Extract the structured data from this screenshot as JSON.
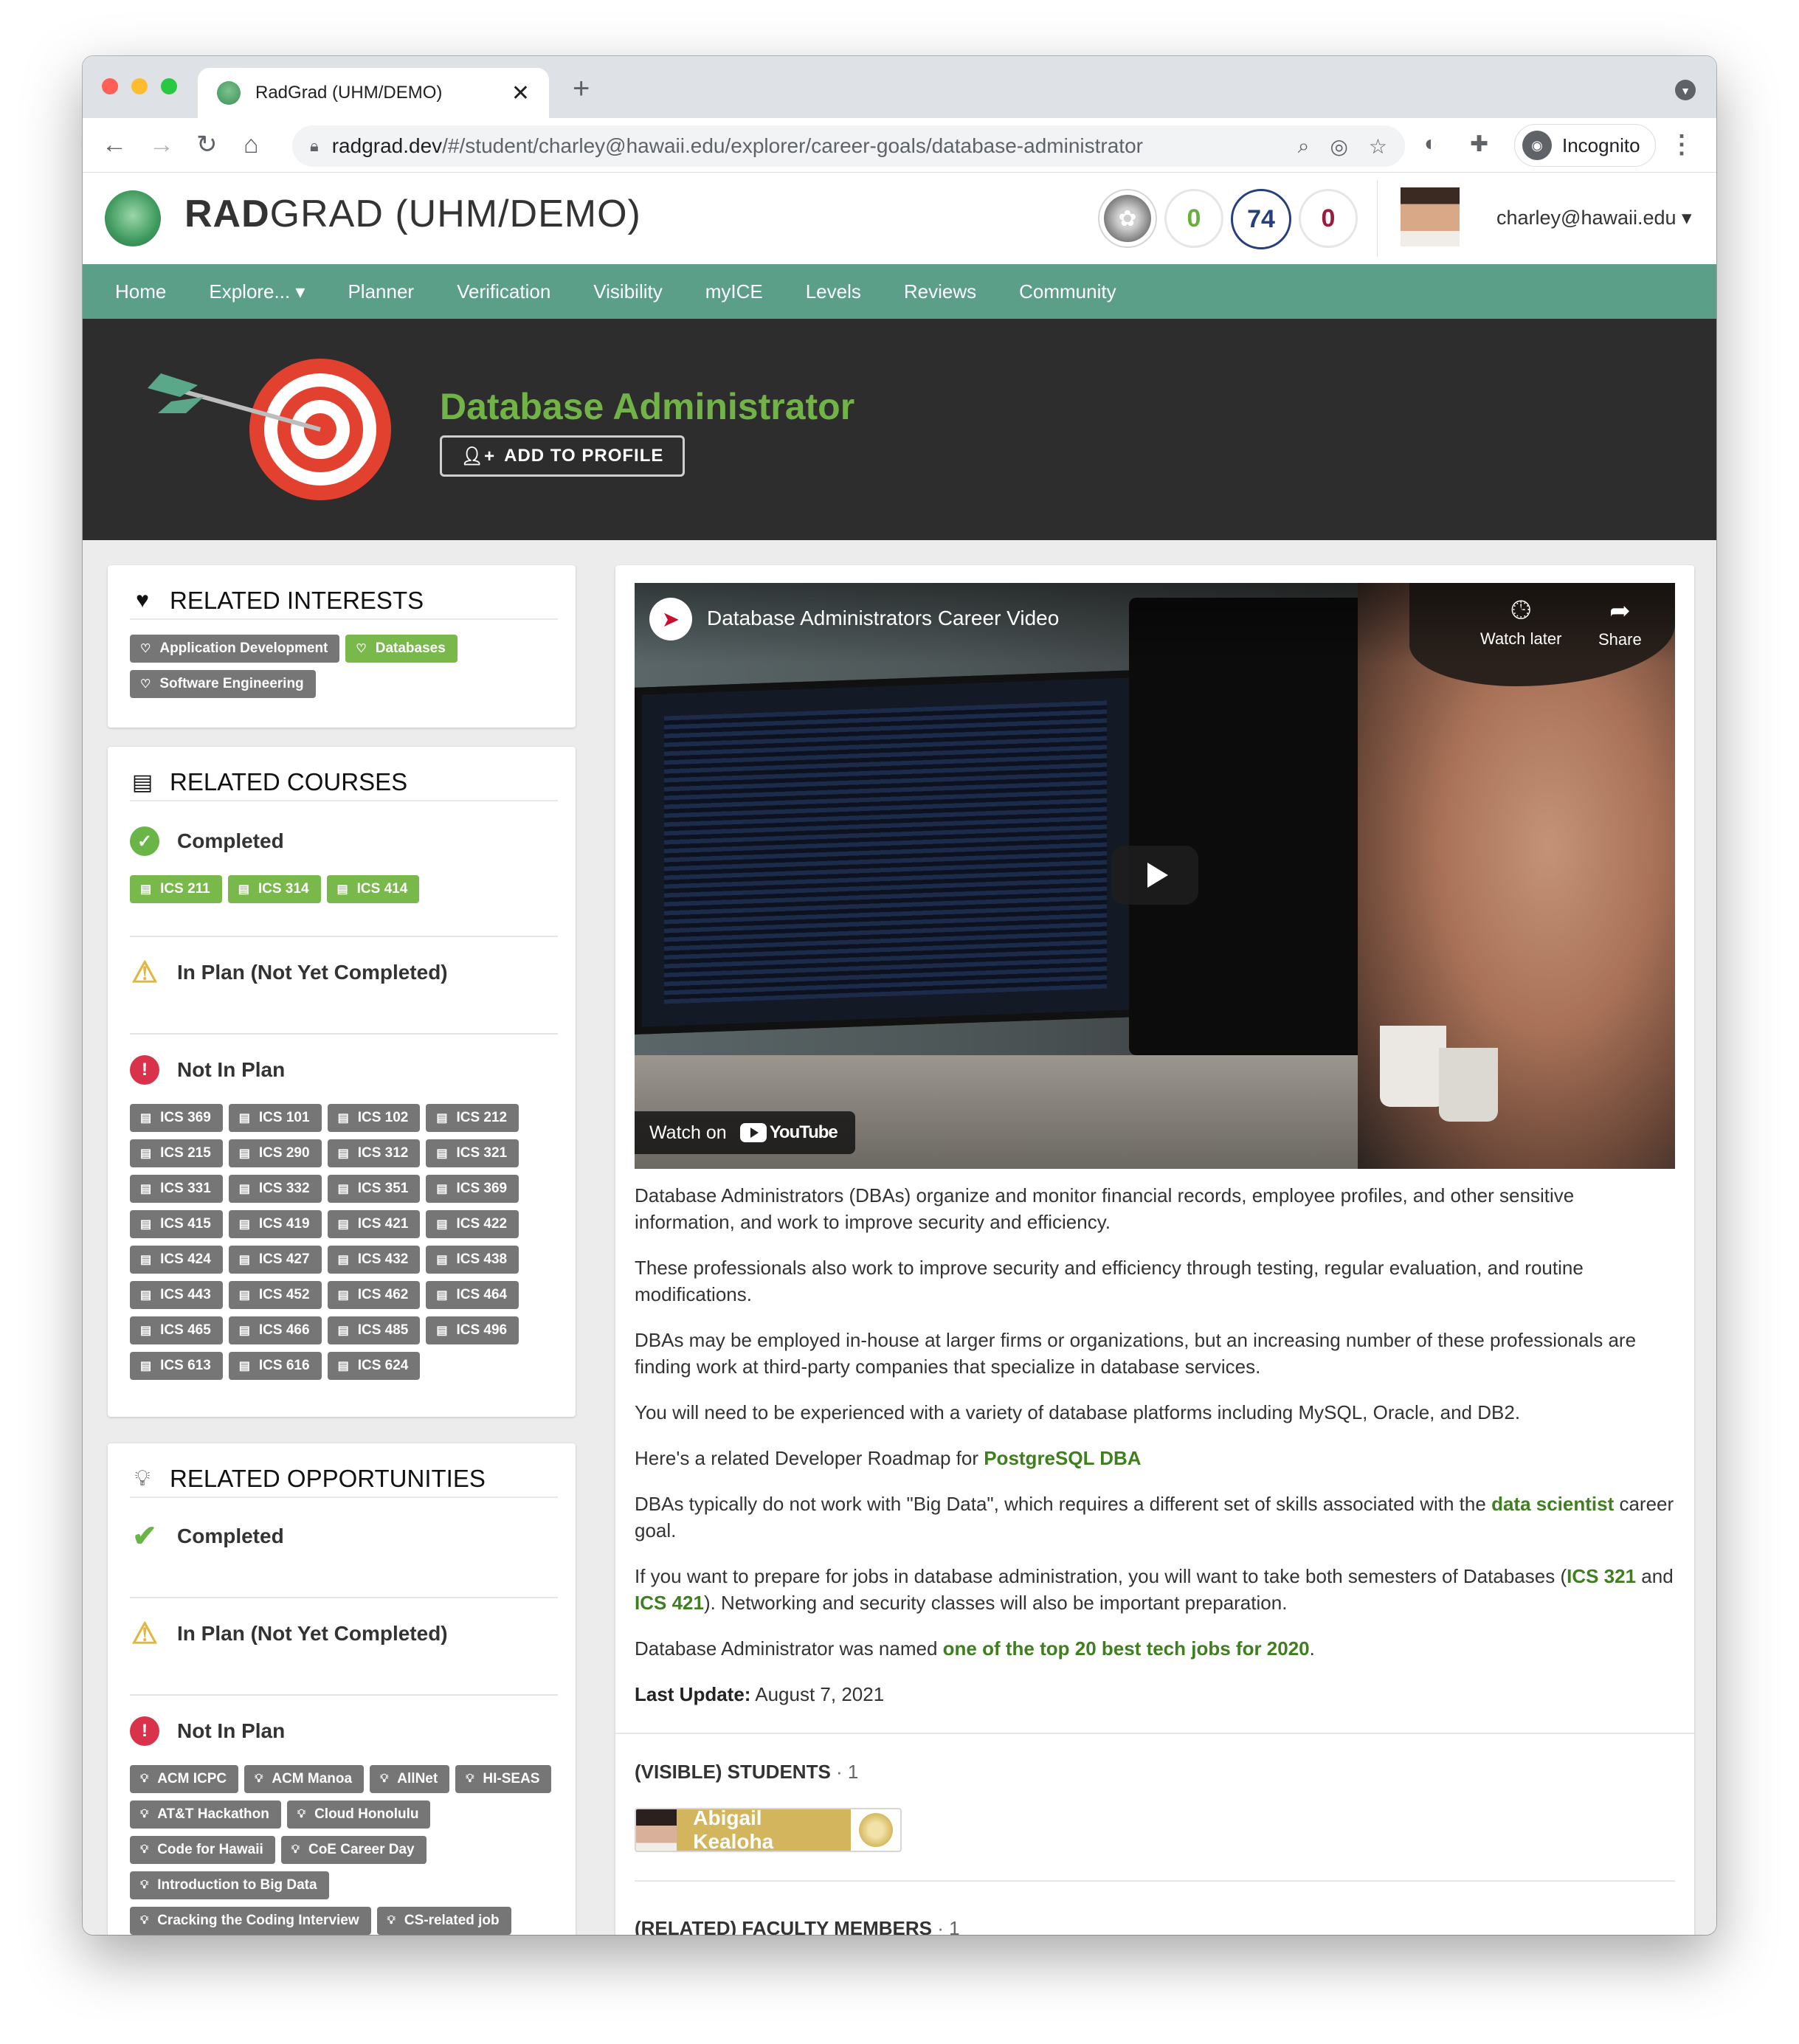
{
  "browser": {
    "tab_title": "RadGrad (UHM/DEMO)",
    "url_host": "radgrad.dev",
    "url_path": "/#/student/charley@hawaii.edu/explorer/career-goals/database-administrator",
    "incognito_label": "Incognito"
  },
  "header": {
    "brand_bold": "RAD",
    "brand_rest": "GRAD (UHM/DEMO)",
    "scores": [
      "0",
      "74",
      "0"
    ],
    "user": "charley@hawaii.edu ▾"
  },
  "nav": [
    "Home",
    "Explore... ▾",
    "Planner",
    "Verification",
    "Visibility",
    "myICE",
    "Levels",
    "Reviews",
    "Community"
  ],
  "hero": {
    "title": "Database Administrator",
    "add_button": "ADD TO PROFILE"
  },
  "interests": {
    "title": "RELATED INTERESTS",
    "items": [
      {
        "label": "Application Development",
        "in_profile": false
      },
      {
        "label": "Databases",
        "in_profile": true
      },
      {
        "label": "Software Engineering",
        "in_profile": false
      }
    ]
  },
  "courses": {
    "title": "RELATED COURSES",
    "completed_label": "Completed",
    "completed": [
      "ICS 211",
      "ICS 314",
      "ICS 414"
    ],
    "in_plan_label": "In Plan (Not Yet Completed)",
    "not_in_plan_label": "Not In Plan",
    "not_in_plan": [
      "ICS 369",
      "ICS 101",
      "ICS 102",
      "ICS 212",
      "ICS 215",
      "ICS 290",
      "ICS 312",
      "ICS 321",
      "ICS 331",
      "ICS 332",
      "ICS 351",
      "ICS 369",
      "ICS 415",
      "ICS 419",
      "ICS 421",
      "ICS 422",
      "ICS 424",
      "ICS 427",
      "ICS 432",
      "ICS 438",
      "ICS 443",
      "ICS 452",
      "ICS 462",
      "ICS 464",
      "ICS 465",
      "ICS 466",
      "ICS 485",
      "ICS 496",
      "ICS 613",
      "ICS 616",
      "ICS 624"
    ]
  },
  "opportunities": {
    "title": "RELATED OPPORTUNITIES",
    "completed_label": "Completed",
    "in_plan_label": "In Plan (Not Yet Completed)",
    "not_in_plan_label": "Not In Plan",
    "not_in_plan": [
      "ACM ICPC",
      "ACM Manoa",
      "AllNet",
      "HI-SEAS",
      "AT&T Hackathon",
      "Cloud Honolulu",
      "Code for Hawaii",
      "CoE Career Day",
      "Introduction to Big Data",
      "Cracking the Coding Interview",
      "CS-related job"
    ]
  },
  "video": {
    "title": "Database Administrators Career Video",
    "watch_later": "Watch later",
    "share": "Share",
    "watch_on": "Watch on",
    "youtube": "YouTube"
  },
  "description": {
    "p1": "Database Administrators (DBAs) organize and monitor financial records, employee profiles, and other sensitive information, and work to improve security and efficiency.",
    "p2": "These professionals also work to improve security and efficiency through testing, regular evaluation, and routine modifications.",
    "p3": "DBAs may be employed in-house at larger firms or organizations, but an increasing number of these professionals are finding work at third-party companies that specialize in database services.",
    "p4": "You will need to be experienced with a variety of database platforms including MySQL, Oracle, and DB2.",
    "p5_pre": "Here's a related Developer Roadmap for ",
    "p5_link": "PostgreSQL DBA",
    "p6_pre": "DBAs typically do not work with \"Big Data\", which requires a different set of skills associated with the ",
    "p6_link": "data scientist",
    "p6_post": " career goal.",
    "p7_pre": "If you want to prepare for jobs in database administration, you will want to take both semesters of Databases (",
    "p7_link1": "ICS 321",
    "p7_mid": " and ",
    "p7_link2": "ICS 421",
    "p7_post": "). Networking and security classes will also be important preparation.",
    "p8_pre": "Database Administrator was named ",
    "p8_link": "one of the top 20 best tech jobs for 2020",
    "p8_post": ".",
    "update_label": "Last Update:",
    "update_value": " August 7, 2021"
  },
  "students": {
    "label": "(VISIBLE) STUDENTS",
    "count": " · 1",
    "name": "Abigail Kealoha"
  },
  "faculty": {
    "label": "(RELATED) FACULTY MEMBERS",
    "count": " · 1"
  },
  "colors": {
    "nav": "#5b9f89",
    "accent_green": "#72b347",
    "chip_grey": "#767676",
    "chip_green": "#79b84a"
  }
}
